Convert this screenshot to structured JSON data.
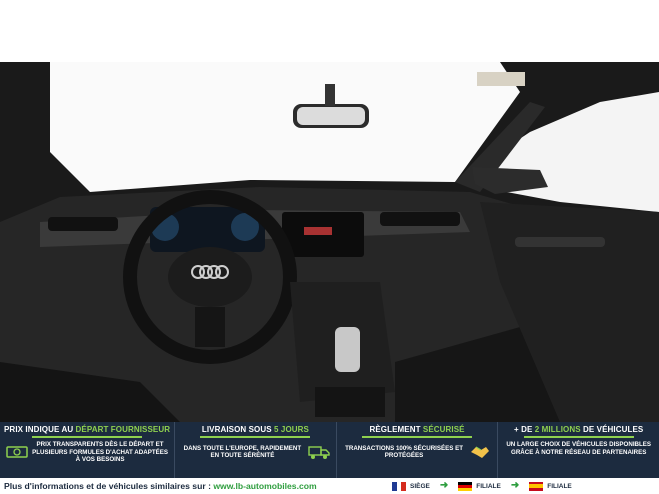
{
  "photo": {
    "alt_icon": "car-interior-photo"
  },
  "banner": {
    "columns": [
      {
        "title_a": "PRIX INDIQUE AU ",
        "title_b": "DÉPART FOURNISSEUR",
        "text": "PRIX TRANSPARENTS DÈS LE DÉPART ET PLUSIEURS FORMULES D'ACHAT ADAPTÉES À VOS BESOINS",
        "icon": "cash-icon"
      },
      {
        "title_a": "LIVRAISON SOUS ",
        "title_b": "5 JOURS",
        "text": "DANS TOUTE L'EUROPE, RAPIDEMENT EN TOUTE SÉRÉNITÉ",
        "icon": "truck-icon"
      },
      {
        "title_a": "RÈGLEMENT ",
        "title_b": "SÉCURISÉ",
        "text": "TRANSACTIONS 100% SÉCURISÉES ET PROTÉGÉES",
        "icon": "handshake-icon"
      },
      {
        "title_a": "+ DE ",
        "title_b": "2 MILLIONS",
        "title_c": " DE VÉHICULES",
        "text": "UN LARGE CHOIX DE VÉHICULES DISPONIBLES GRÂCE À NOTRE RÉSEAU DE PARTENAIRES",
        "icon": "car-icon"
      }
    ]
  },
  "footer": {
    "text": "Plus d'informations et de véhicules similaires sur : ",
    "link": "www.lb-automobiles.com",
    "flags": [
      {
        "label": "SIÈGE",
        "country": "France"
      },
      {
        "label": "FILIALE",
        "country": "Germany"
      },
      {
        "label": "FILIALE",
        "country": "Spain"
      }
    ]
  },
  "colors": {
    "banner_bg": "#1c2b3f",
    "accent_green": "#8fd14f",
    "link_green": "#2f9e3f"
  }
}
